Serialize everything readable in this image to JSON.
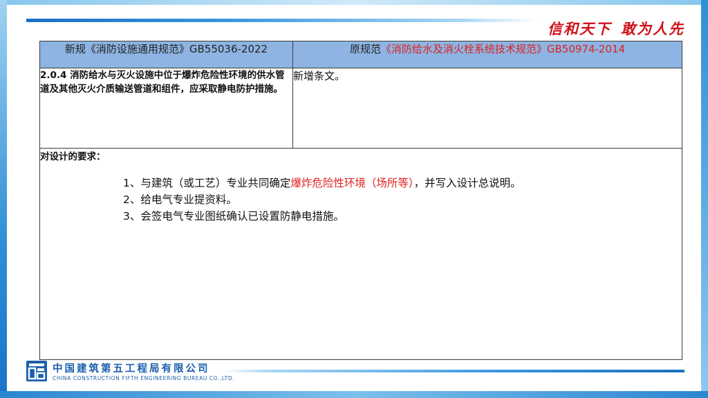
{
  "slogan": {
    "part1": "信和天下",
    "part2": "敢为人先"
  },
  "table": {
    "header_new_prefix": "新规《消防设施通用规范》GB55036-2022",
    "header_old_prefix": "原规范",
    "header_old_name": "《消防给水及消火栓系统技术规范》GB50974-2014",
    "clause_text": "2.0.4 消防给水与灭火设施中位于爆炸危险性环境的供水管道及其他灭火介质输送管道和组件，应采取静电防护措施。",
    "old_status": "新增条文。",
    "requirements_title": "对设计的要求：",
    "requirements": [
      {
        "pre": "1、与建筑（或工艺）专业共同确定",
        "highlight": "爆炸危险性环境（场所等）",
        "post": "，并写入设计总说明。"
      },
      {
        "pre": "2、给电气专业提资料。",
        "highlight": "",
        "post": ""
      },
      {
        "pre": "3、会签电气专业图纸确认已设置防静电措施。",
        "highlight": "",
        "post": ""
      }
    ]
  },
  "footer": {
    "company_cn": "中国建筑第五工程局有限公司",
    "company_en": "CHINA CONSTRUCTION FIFTH ENGINEERING BUREAU CO.,LTD."
  },
  "colors": {
    "accent_red": "#e02020",
    "header_blue": "#8db4e2",
    "brand_blue": "#1b5fae"
  }
}
